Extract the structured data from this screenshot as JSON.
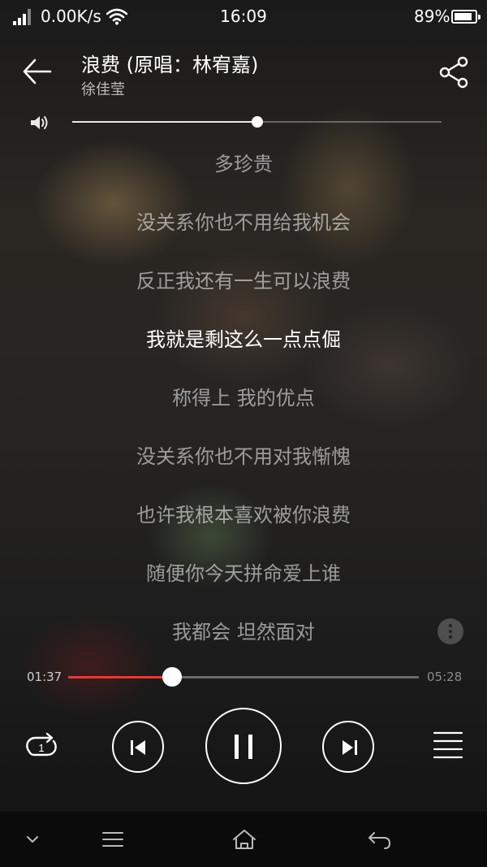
{
  "status_bar": {
    "net_speed": "0.00K/s",
    "time": "16:09",
    "battery_percent": "89%",
    "battery_level": 0.89,
    "signal_icon": "signal-bars-icon",
    "wifi_icon": "wifi-icon"
  },
  "header": {
    "title": "浪费 (原唱：林宥嘉)",
    "artist": "徐佳莹",
    "back_icon": "arrow-left-icon",
    "share_icon": "share-icon"
  },
  "volume": {
    "icon": "speaker-icon",
    "level": 0.5
  },
  "lyrics": {
    "lines": [
      "多珍贵",
      "没关系你也不用给我机会",
      "反正我还有一生可以浪费",
      "我就是剩这么一点点倔",
      "称得上 我的优点",
      "没关系你也不用对我惭愧",
      "也许我根本喜欢被你浪费",
      "随便你今天拼命爱上谁",
      "我都会 坦然面对"
    ],
    "current_index": 3
  },
  "playback": {
    "elapsed": "01:37",
    "total": "05:28",
    "progress": 0.296
  },
  "controls": {
    "repeat_icon": "repeat-one-icon",
    "repeat_badge": "1",
    "prev_icon": "skip-previous-icon",
    "play_icon": "pause-icon",
    "next_icon": "skip-next-icon",
    "playlist_icon": "playlist-icon",
    "more_icon": "more-vertical-icon"
  },
  "colors": {
    "accent": "#e23a3a",
    "lyric_current": "#ffffff",
    "lyric_other": "#8f8f8f"
  },
  "navbar": {
    "icons": [
      "chevron-down-icon",
      "menu-icon",
      "home-icon",
      "back-icon"
    ]
  }
}
